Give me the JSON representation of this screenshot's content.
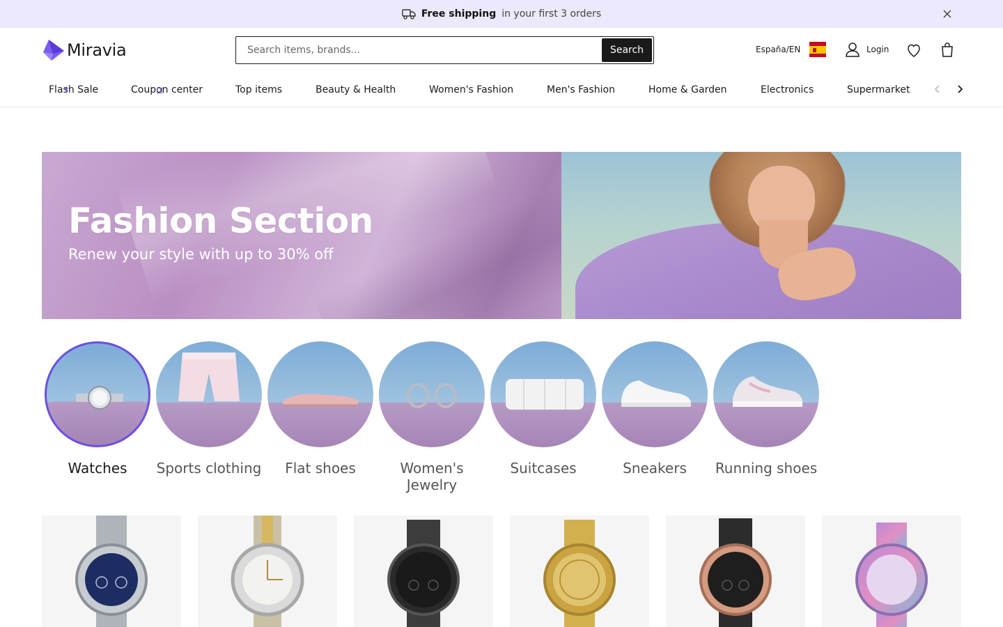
{
  "promo": {
    "bold": "Free shipping",
    "rest": "in your first 3 orders"
  },
  "header": {
    "brand": "Miravia",
    "search_placeholder": "Search items, brands...",
    "search_button": "Search",
    "locale": "España/EN",
    "login": "Login"
  },
  "nav": {
    "items": [
      "Flash Sale",
      "Coupon center",
      "Top items",
      "Beauty & Health",
      "Women's Fashion",
      "Men's Fashion",
      "Home & Garden",
      "Electronics",
      "Supermarket"
    ]
  },
  "hero": {
    "title": "Fashion Section",
    "subtitle": "Renew your style with up to 30% off"
  },
  "categories": [
    {
      "label": "Watches",
      "selected": true
    },
    {
      "label": "Sports clothing"
    },
    {
      "label": "Flat shoes"
    },
    {
      "label": "Women's Jewelry"
    },
    {
      "label": "Suitcases"
    },
    {
      "label": "Sneakers"
    },
    {
      "label": "Running shoes"
    }
  ],
  "colors": {
    "accent": "#6a4fe0",
    "promo_bg": "#ebe9fb"
  }
}
